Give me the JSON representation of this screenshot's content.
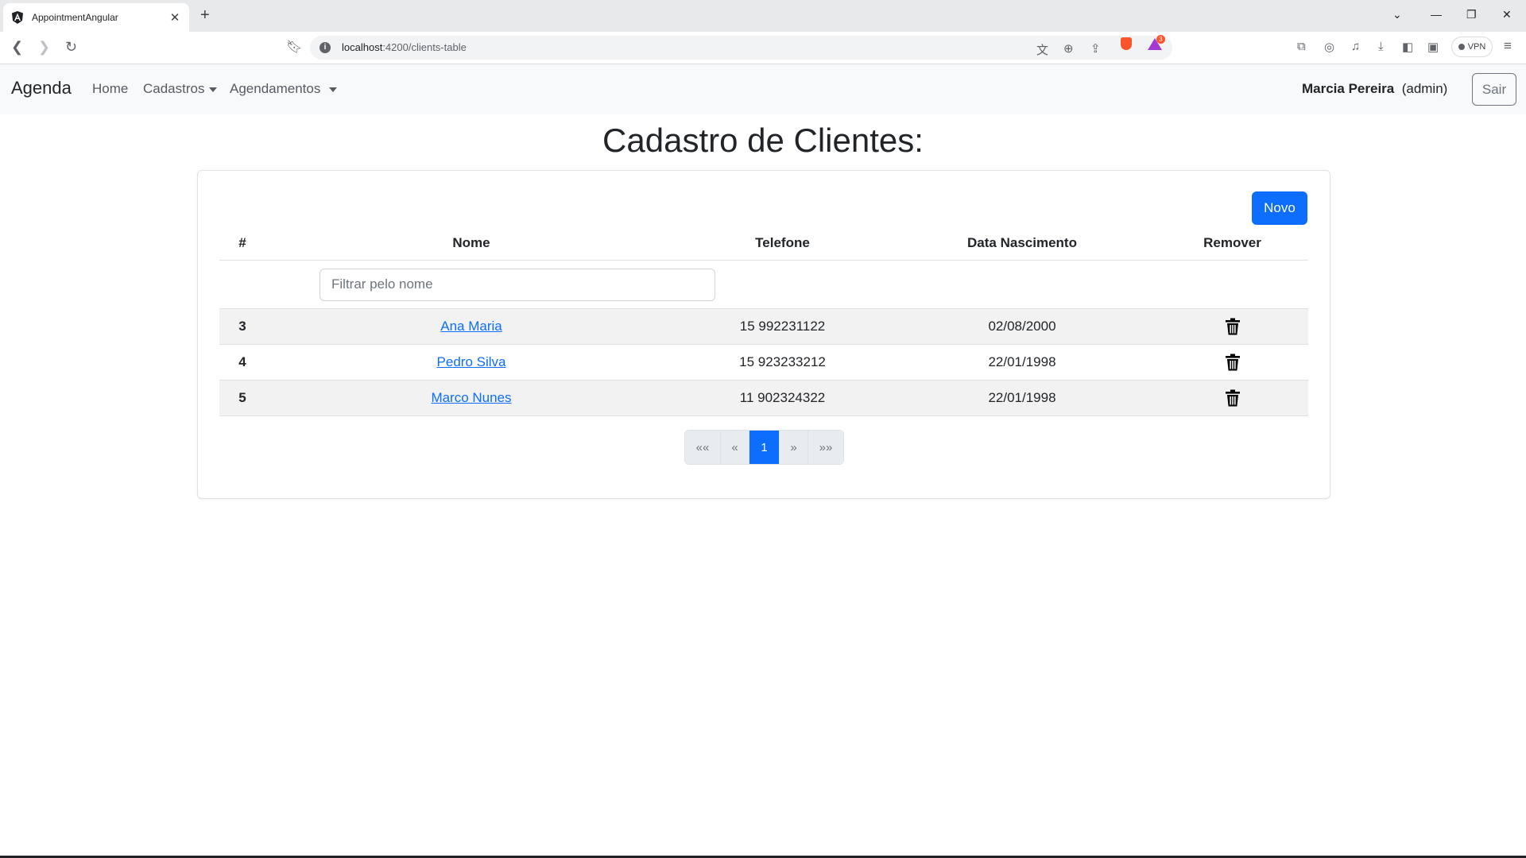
{
  "browser": {
    "tab_title": "AppointmentAngular",
    "tab_close": "✕",
    "new_tab": "+",
    "url_host": "localhost",
    "url_path": ":4200/clients-table",
    "rewards_count": "3",
    "vpn_label": "VPN",
    "brave_color": "#fb542b"
  },
  "navbar": {
    "brand": "Agenda",
    "links": [
      "Home",
      "Cadastros",
      "Agendamentos"
    ],
    "user_name": "Marcia Pereira",
    "user_role": "(admin)",
    "logout_label": "Sair"
  },
  "page": {
    "title": "Cadastro de Clientes:",
    "new_button": "Novo",
    "accent_color": "#0d6efd"
  },
  "table": {
    "headers": [
      "#",
      "Nome",
      "Telefone",
      "Data Nascimento",
      "Remover"
    ],
    "filter_placeholder": "Filtrar pelo nome",
    "filter_value": "",
    "rows": [
      {
        "id": "3",
        "name": "Ana Maria",
        "phone": "15 992231122",
        "birth": "02/08/2000"
      },
      {
        "id": "4",
        "name": "Pedro Silva",
        "phone": "15 923233212",
        "birth": "22/01/1998"
      },
      {
        "id": "5",
        "name": "Marco Nunes",
        "phone": "11 902324322",
        "birth": "22/01/1998"
      }
    ],
    "remove_icon": "trash-icon"
  },
  "pagination": {
    "first": "««",
    "prev": "«",
    "current": "1",
    "next": "»",
    "last": "»»"
  }
}
